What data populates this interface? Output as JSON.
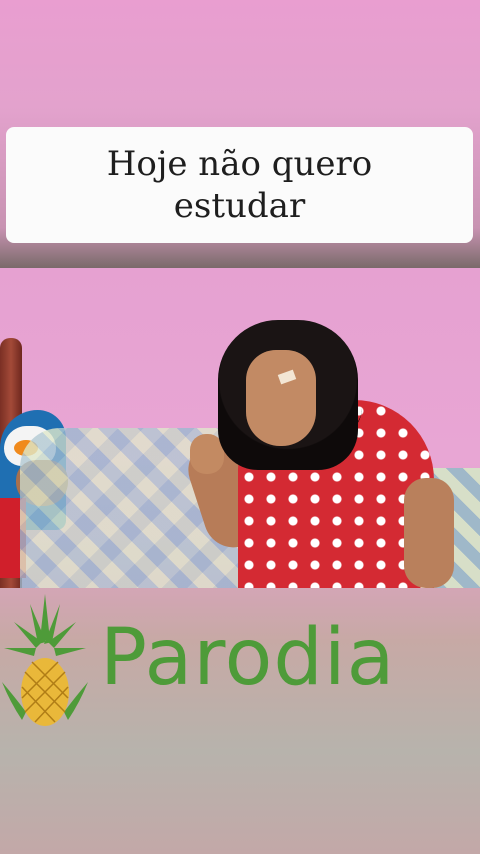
{
  "caption": {
    "line1": "Hoje não quero",
    "line2": "estudar"
  },
  "logo": {
    "text": "Parodia",
    "icon": "pineapple-icon",
    "color": "#4e9b39"
  },
  "colors": {
    "caption_bg": "#fbfbfb",
    "caption_text": "#1e1e1e",
    "background_pink": "#e6a1d1"
  }
}
